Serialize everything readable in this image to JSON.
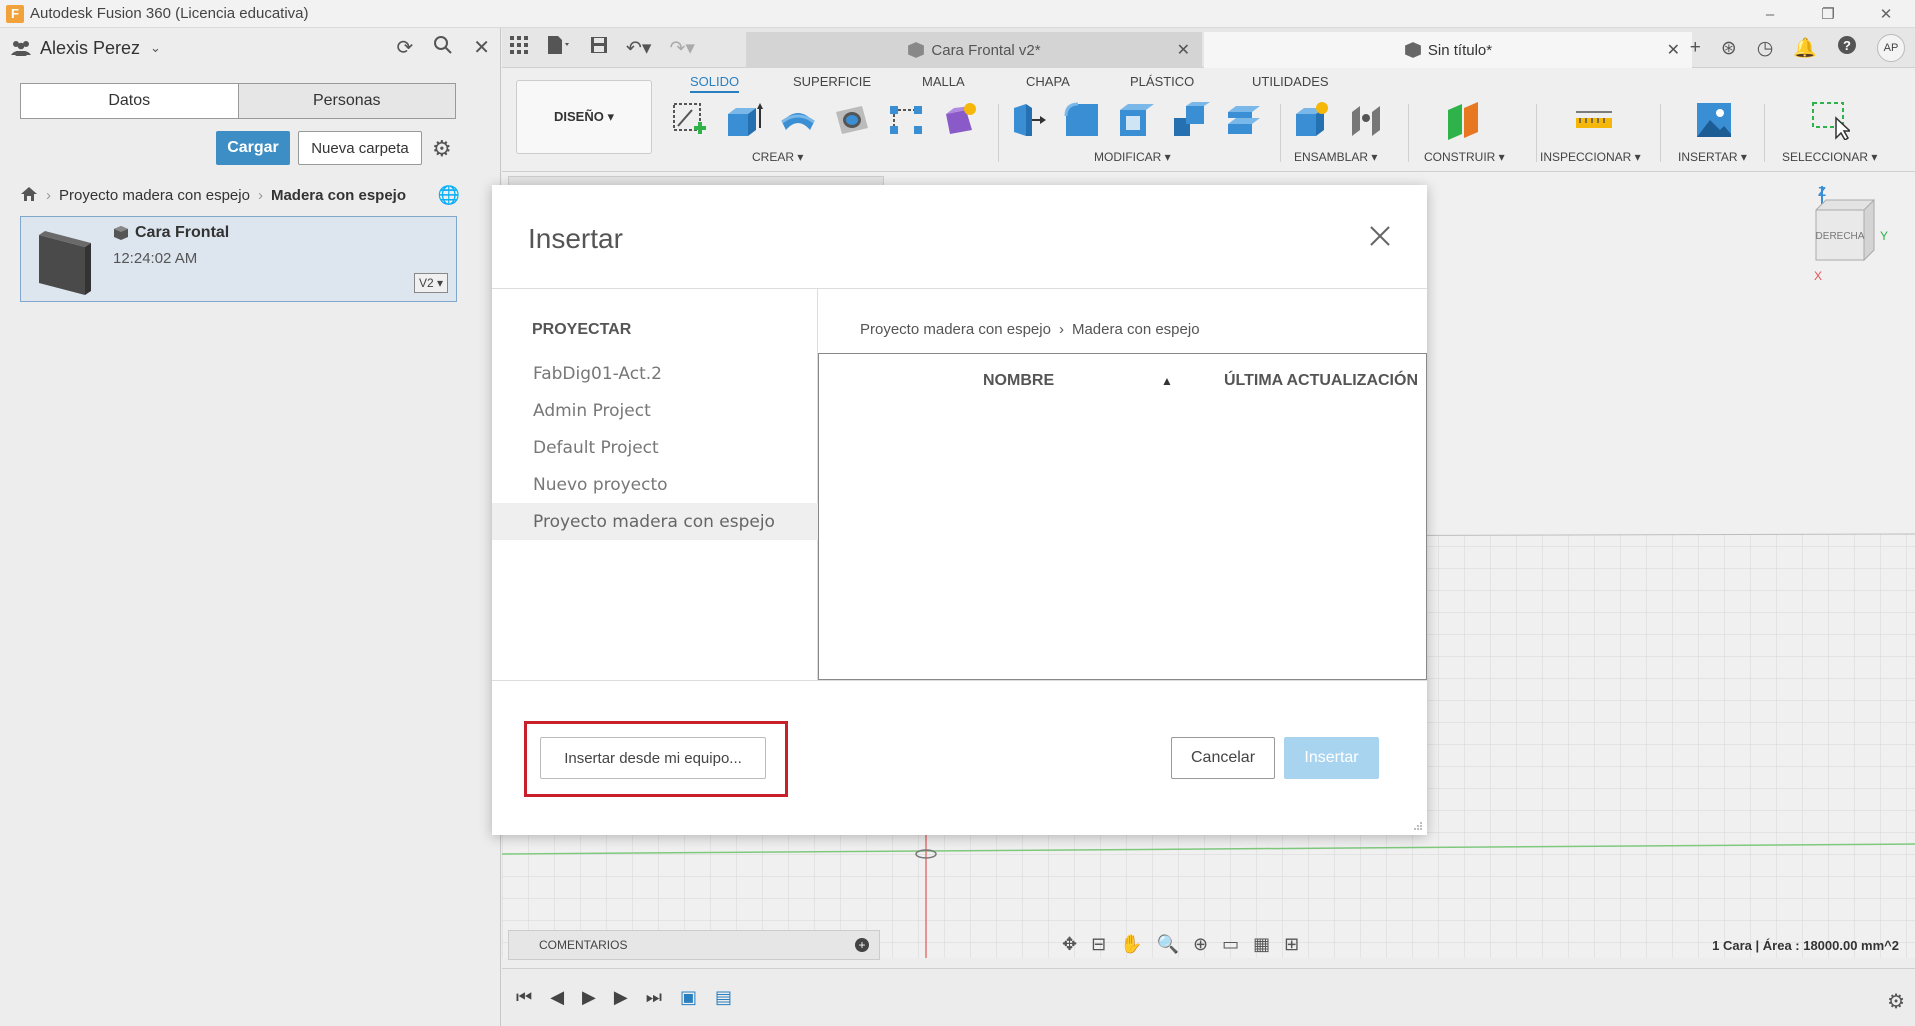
{
  "window": {
    "title": "Autodesk Fusion 360 (Licencia educativa)",
    "logo_letter": "F"
  },
  "data_panel": {
    "user_name": "Alexis Perez",
    "tabs": [
      "Datos",
      "Personas"
    ],
    "upload_label": "Cargar",
    "new_folder_label": "Nueva carpeta",
    "breadcrumb": [
      "Proyecto madera con espejo",
      "Madera con espejo"
    ],
    "file": {
      "name": "Cara Frontal",
      "time": "12:24:02 AM",
      "version": "V2 ▾"
    }
  },
  "doc_tabs": [
    {
      "label": "Cara Frontal v2*",
      "active": false
    },
    {
      "label": "Sin título*",
      "active": true
    }
  ],
  "user_initials": "AP",
  "ribbon": {
    "workspace": "DISEÑO ▾",
    "tabs": [
      "SOLIDO",
      "SUPERFICIE",
      "MALLA",
      "CHAPA",
      "PLÁSTICO",
      "UTILIDADES"
    ],
    "active_tab": "SOLIDO",
    "groups": [
      "CREAR ▾",
      "MODIFICAR ▾",
      "ENSAMBLAR ▾",
      "CONSTRUIR ▾",
      "INSPECCIONAR ▾",
      "INSERTAR ▾",
      "SELECCIONAR ▾"
    ]
  },
  "viewcube": {
    "face": "DERECHA",
    "axes": [
      "Z",
      "Y",
      "X"
    ]
  },
  "modal": {
    "title": "Insertar",
    "projects_heading": "PROYECTAR",
    "projects": [
      "FabDig01-Act.2",
      "Admin Project",
      "Default Project",
      "Nuevo proyecto",
      "Proyecto madera con espejo"
    ],
    "selected_project": "Proyecto madera con espejo",
    "breadcrumb": [
      "Proyecto madera con espejo",
      "Madera con espejo"
    ],
    "columns": [
      "NOMBRE",
      "ÚLTIMA ACTUALIZACIÓN"
    ],
    "sort_indicator": "▲",
    "insert_local_label": "Insertar desde mi equipo...",
    "cancel_label": "Cancelar",
    "insert_label": "Insertar"
  },
  "bottom": {
    "comments_label": "COMENTARIOS",
    "status": "1 Cara | Área : 18000.00 mm^2"
  },
  "colors": {
    "accent": "#3c8ec4",
    "highlight": "#c8202a",
    "insert_disabled": "#a8d4f0"
  }
}
